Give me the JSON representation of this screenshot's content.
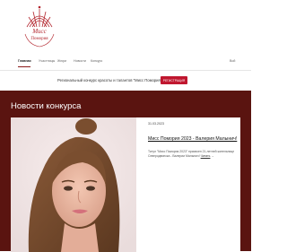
{
  "brand": {
    "logo_line1": "Мисс",
    "logo_line2": "Помория",
    "accent_color": "#c0172f",
    "logo_color": "#b3262e"
  },
  "nav": {
    "items": [
      {
        "label": "Главная",
        "active": true
      },
      {
        "label": "Участницы",
        "active": false
      },
      {
        "label": "Жюри",
        "active": false
      },
      {
        "label": "Новости",
        "active": false
      },
      {
        "label": "Конкурс",
        "active": false
      }
    ],
    "right_label": "Вой"
  },
  "promo": {
    "text": "Региональный конкурс красоты и талантов \"Мисс Помория\"",
    "button_label": "РЕГИСТРАЦИЯ"
  },
  "news": {
    "section_title": "Новости конкурса",
    "background_color": "#5a1410",
    "article": {
      "date": "31.03.2023",
      "headline": "Мисс Помория 2023 - Валерия Малынич!",
      "excerpt": "Титул \"Мисс Помория 2023\" присвоен 21-летней жительнице Северодвинска - Валерии Малынич!",
      "more_label": "Читать",
      "more_suffix": "→"
    }
  }
}
